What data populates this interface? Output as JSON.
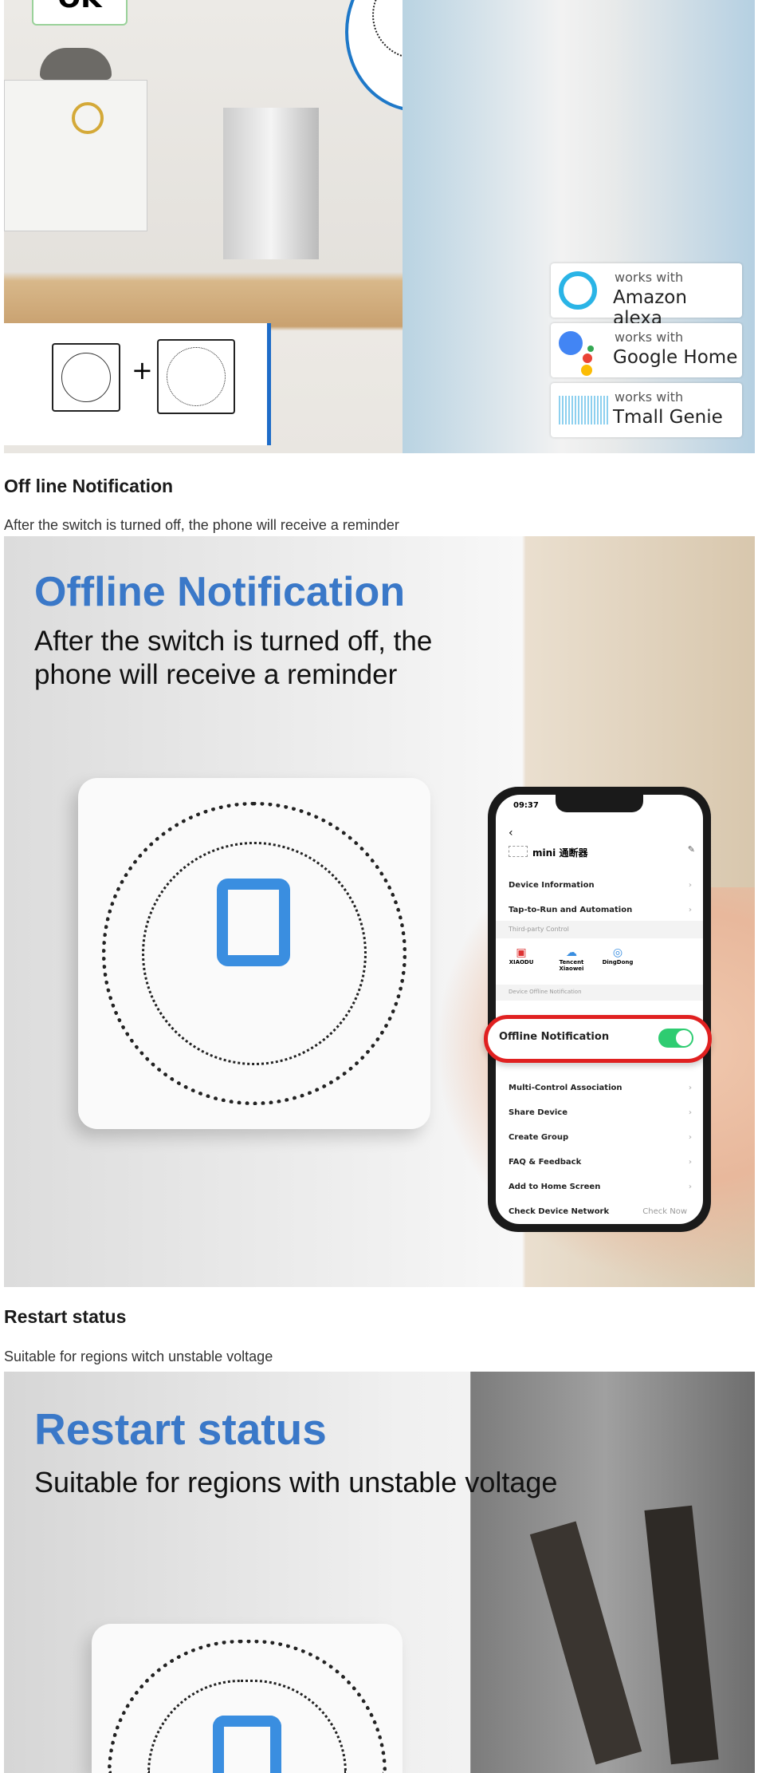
{
  "image1": {
    "speech_bubble": "OK",
    "plus_sign": "+",
    "badges": [
      {
        "works": "works with",
        "name": "Amazon alexa",
        "icon": "alexa-ring-icon"
      },
      {
        "works": "works with",
        "name": "Google Home",
        "icon": "google-assistant-icon"
      },
      {
        "works": "works with",
        "name": "Tmall Genie",
        "icon": "tmall-genie-icon"
      }
    ]
  },
  "sections": [
    {
      "heading": "Off line Notification",
      "text": "After the switch is turned off, the phone will receive a reminder"
    },
    {
      "heading": "Restart status",
      "text": "Suitable for regions witch unstable voltage"
    }
  ],
  "image2": {
    "title": "Offline Notification",
    "subtitle_line1": "After the switch is turned off, the",
    "subtitle_line2": "phone will receive a reminder",
    "title_color": "#3a78c8",
    "phone": {
      "time": "09:37",
      "device_name": "mini 通断器",
      "rows_top": [
        "Device Information",
        "Tap-to-Run and Automation"
      ],
      "third_party_label": "Third-party Control",
      "third_party": [
        "XIAODU",
        "Tencent Xiaowei",
        "DingDong"
      ],
      "offline_section_label": "Device Offline Notification",
      "offline_toggle_label": "Offline Notification",
      "offline_toggle_on": true,
      "toggle_color": "#2ecc71",
      "highlight_color": "#e02020",
      "rows_bottom": [
        "Multi-Control Association",
        "Share Device",
        "Create Group",
        "FAQ & Feedback",
        "Add to Home Screen"
      ],
      "network_row": "Check Device Network",
      "network_action": "Check Now"
    }
  },
  "image3": {
    "title": "Restart status",
    "subtitle": "Suitable for regions with unstable voltage",
    "title_color": "#3a78c8"
  }
}
